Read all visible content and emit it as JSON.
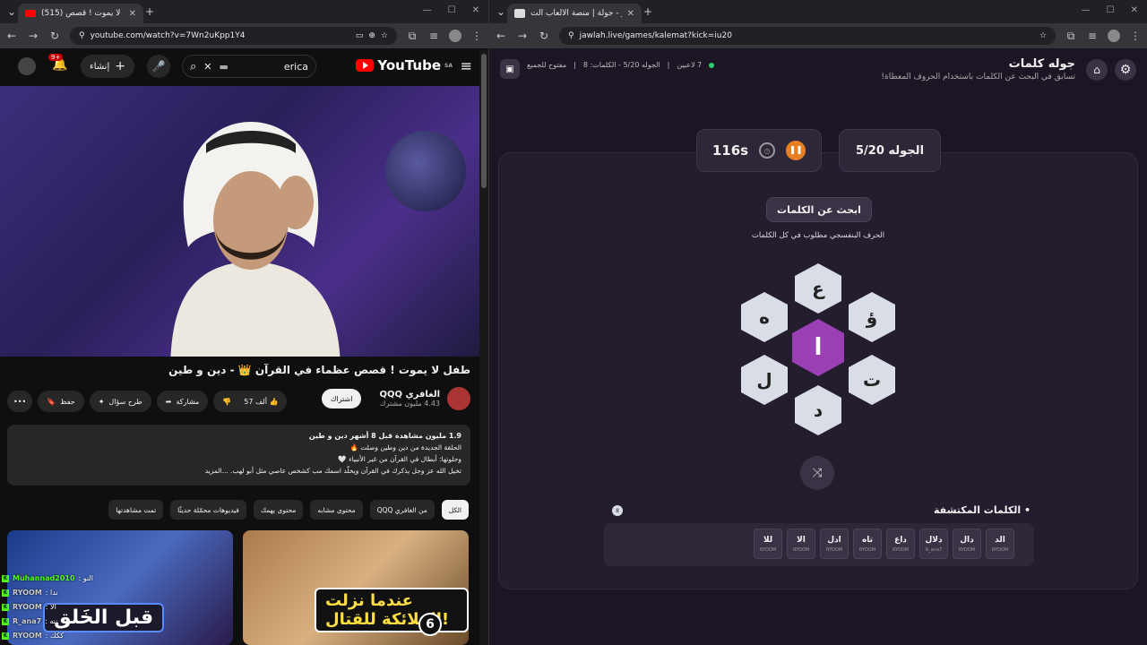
{
  "left_window": {
    "tab_title": "(515) طفل لا يموت ! قصص",
    "url": "youtube.com/watch?v=7Wn2uKpp1Y4",
    "youtube": {
      "logo_text": "YouTube",
      "region": "SA",
      "search_term": "erica",
      "create_label": "إنشاء",
      "notif_badge": "9+",
      "video_title": "طفل لا يموت ! قصص عظماء في القرآن 👑 - دين و طين",
      "channel_name": "الغافري QQQ",
      "channel_subs": "4.43 مليون مشترك",
      "subscribe_label": "اشتراك",
      "likes": "57 ألف",
      "share_label": "مشاركة",
      "ask_label": "طرح سؤال",
      "save_label": "حفظ",
      "more_label": "•••",
      "desc_stats": "1.9 مليون مشاهدة  قبل 8 أشهر  دين و طين",
      "desc_line1": "الحلقة الجديدة من دين وطين وصلت 🔥",
      "desc_line2": "وحلوتها: أبطال في القرآن من غير الأنبياء 🤍",
      "desc_line3": "تخيل الله عز وجل يذكرك في القرآن ويخلّد اسمك مب كشخص عاصي مثل أبو لهب. ...المزيد",
      "chips": [
        "الكل",
        "من الغافري QQQ",
        "محتوى مشابه",
        "محتوى يهمك",
        "فيديوهات محمّلة حديثًا",
        "تمت مشاهدتها"
      ],
      "thumb1_text": "قبل الخَلق",
      "thumb2_text": "عندما نزلت الملائكة للقتال!",
      "thumb2_num": "6"
    },
    "chat": [
      {
        "user": "Muhannad2010",
        "msg": ": النو",
        "color": "green"
      },
      {
        "user": "RYOOM",
        "msg": ": ندا",
        "color": "grey"
      },
      {
        "user": "RYOOM",
        "msg": ": الا",
        "color": "grey"
      },
      {
        "user": "R_ana7",
        "msg": ": ننه",
        "color": "grey"
      },
      {
        "user": "RYOOM",
        "msg": ": ككك",
        "color": "grey"
      }
    ]
  },
  "right_window": {
    "tab_title": "جولة | منصة الألعاب الت - Jawlah",
    "url": "jawlah.live/games/kalemat?kick=iu20",
    "game": {
      "title": "جوله كلمات",
      "subtitle": "تسابق في البحث عن الكلمات باستخدام الحروف المعطاة!",
      "players": "7 لاعبين",
      "round_info": "الجوله 5/20 - الكلمات: 8",
      "open_label": "مفتوح للجميع",
      "round_label": "الجوله 5/20",
      "timer": "116s",
      "find_button": "ابحث عن الكلمات",
      "hint": "الحرف البنفسجي مطلوب في كل الكلمات",
      "letters": {
        "center": "ا",
        "top": "ع",
        "top_right": "ؤ",
        "bottom_right": "ت",
        "bottom": "د",
        "bottom_left": "ل",
        "top_left": "ه"
      },
      "found_title": "• الكلمات المكتشفة",
      "found_count": "8",
      "found_words": [
        {
          "word": "الد",
          "by": "RYOOM"
        },
        {
          "word": "دال",
          "by": "RYOOM"
        },
        {
          "word": "دلال",
          "by": "R_ana7"
        },
        {
          "word": "داع",
          "by": "RYOOM"
        },
        {
          "word": "تاه",
          "by": "RYOOM"
        },
        {
          "word": "ادل",
          "by": "RYOOM"
        },
        {
          "word": "الا",
          "by": "RYOOM"
        },
        {
          "word": "للا",
          "by": "RYOOM"
        }
      ]
    }
  }
}
